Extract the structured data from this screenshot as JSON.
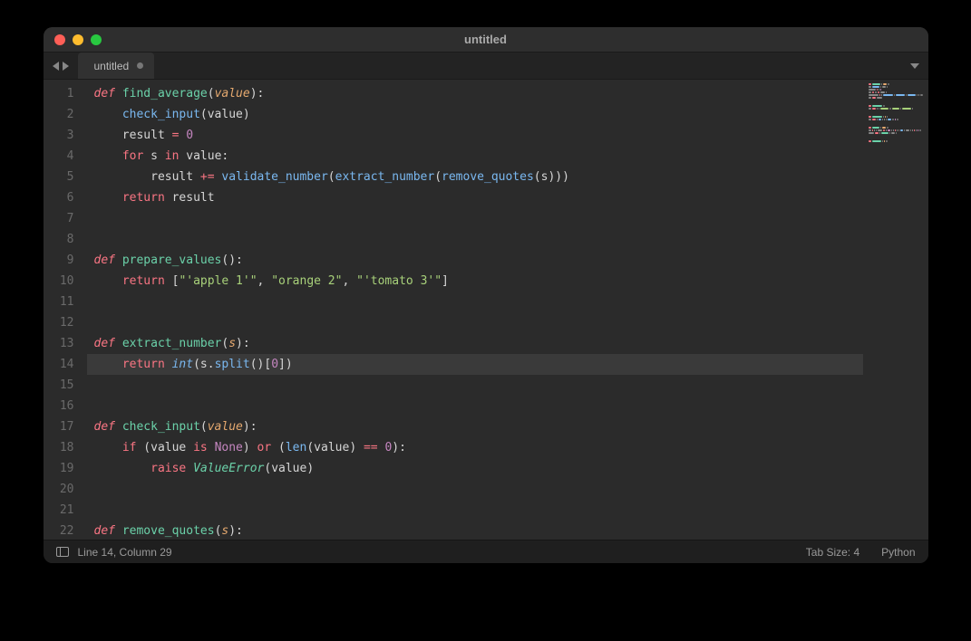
{
  "window": {
    "title": "untitled"
  },
  "tab": {
    "label": "untitled"
  },
  "gutter": {
    "lines": [
      "1",
      "2",
      "3",
      "4",
      "5",
      "6",
      "7",
      "8",
      "9",
      "10",
      "11",
      "12",
      "13",
      "14",
      "15",
      "16",
      "17",
      "18",
      "19",
      "20",
      "21",
      "22"
    ]
  },
  "code": {
    "highlighted_line": 14,
    "tokens": [
      [
        [
          "kw",
          "def "
        ],
        [
          "fn",
          "find_average"
        ],
        [
          "punct",
          "("
        ],
        [
          "param",
          "value"
        ],
        [
          "punct",
          "):"
        ]
      ],
      [
        [
          "var",
          "    "
        ],
        [
          "fncall",
          "check_input"
        ],
        [
          "punct",
          "("
        ],
        [
          "var",
          "value"
        ],
        [
          "punct",
          ")"
        ]
      ],
      [
        [
          "var",
          "    result "
        ],
        [
          "op",
          "="
        ],
        [
          "var",
          " "
        ],
        [
          "num",
          "0"
        ]
      ],
      [
        [
          "var",
          "    "
        ],
        [
          "kw2",
          "for"
        ],
        [
          "var",
          " s "
        ],
        [
          "kw2",
          "in"
        ],
        [
          "var",
          " value"
        ],
        [
          "punct",
          ":"
        ]
      ],
      [
        [
          "var",
          "        result "
        ],
        [
          "op",
          "+="
        ],
        [
          "var",
          " "
        ],
        [
          "fncall",
          "validate_number"
        ],
        [
          "punct",
          "("
        ],
        [
          "fncall",
          "extract_number"
        ],
        [
          "punct",
          "("
        ],
        [
          "fncall",
          "remove_quotes"
        ],
        [
          "punct",
          "("
        ],
        [
          "var",
          "s"
        ],
        [
          "punct",
          ")))"
        ]
      ],
      [
        [
          "var",
          "    "
        ],
        [
          "kw2",
          "return"
        ],
        [
          "var",
          " result"
        ]
      ],
      [],
      [],
      [
        [
          "kw",
          "def "
        ],
        [
          "fn",
          "prepare_values"
        ],
        [
          "punct",
          "():"
        ]
      ],
      [
        [
          "var",
          "    "
        ],
        [
          "kw2",
          "return"
        ],
        [
          "var",
          " "
        ],
        [
          "punct",
          "["
        ],
        [
          "str",
          "\"'apple 1'\""
        ],
        [
          "punct",
          ", "
        ],
        [
          "str",
          "\"orange 2\""
        ],
        [
          "punct",
          ", "
        ],
        [
          "str",
          "\"'tomato 3'\""
        ],
        [
          "punct",
          "]"
        ]
      ],
      [],
      [],
      [
        [
          "kw",
          "def "
        ],
        [
          "fn",
          "extract_number"
        ],
        [
          "punct",
          "("
        ],
        [
          "param",
          "s"
        ],
        [
          "punct",
          "):"
        ]
      ],
      [
        [
          "var",
          "    "
        ],
        [
          "kw2",
          "return"
        ],
        [
          "var",
          " "
        ],
        [
          "builtin",
          "int"
        ],
        [
          "punct",
          "("
        ],
        [
          "var",
          "s"
        ],
        [
          "punct",
          "."
        ],
        [
          "fncall",
          "split"
        ],
        [
          "punct",
          "()["
        ],
        [
          "num",
          "0"
        ],
        [
          "punct",
          "])"
        ]
      ],
      [],
      [],
      [
        [
          "kw",
          "def "
        ],
        [
          "fn",
          "check_input"
        ],
        [
          "punct",
          "("
        ],
        [
          "param",
          "value"
        ],
        [
          "punct",
          "):"
        ]
      ],
      [
        [
          "var",
          "    "
        ],
        [
          "kw2",
          "if"
        ],
        [
          "var",
          " "
        ],
        [
          "punct",
          "("
        ],
        [
          "var",
          "value "
        ],
        [
          "kw2",
          "is"
        ],
        [
          "var",
          " "
        ],
        [
          "const",
          "None"
        ],
        [
          "punct",
          ")"
        ],
        [
          "var",
          " "
        ],
        [
          "kw2",
          "or"
        ],
        [
          "var",
          " "
        ],
        [
          "punct",
          "("
        ],
        [
          "fncall",
          "len"
        ],
        [
          "punct",
          "("
        ],
        [
          "var",
          "value"
        ],
        [
          "punct",
          ")"
        ],
        [
          "var",
          " "
        ],
        [
          "op",
          "=="
        ],
        [
          "var",
          " "
        ],
        [
          "num",
          "0"
        ],
        [
          "punct",
          "):"
        ]
      ],
      [
        [
          "var",
          "        "
        ],
        [
          "kw2",
          "raise"
        ],
        [
          "var",
          " "
        ],
        [
          "typ",
          "ValueError"
        ],
        [
          "punct",
          "("
        ],
        [
          "var",
          "value"
        ],
        [
          "punct",
          ")"
        ]
      ],
      [],
      [],
      [
        [
          "kw",
          "def "
        ],
        [
          "fn",
          "remove_quotes"
        ],
        [
          "punct",
          "("
        ],
        [
          "param",
          "s"
        ],
        [
          "punct",
          "):"
        ]
      ]
    ]
  },
  "status": {
    "cursor": "Line 14, Column 29",
    "tabsize": "Tab Size: 4",
    "lang": "Python"
  }
}
